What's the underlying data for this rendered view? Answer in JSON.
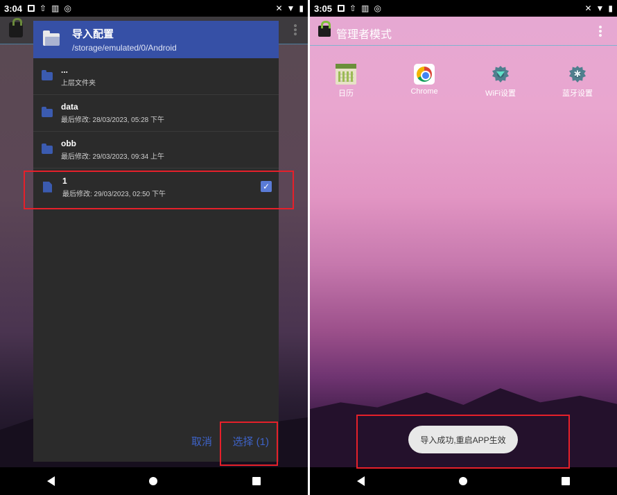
{
  "left": {
    "status": {
      "time": "3:04"
    },
    "dialog": {
      "title": "导入配置",
      "path": "/storage/emulated/0/Android",
      "items": [
        {
          "name": "...",
          "sub": "上层文件夹",
          "type": "folder"
        },
        {
          "name": "data",
          "sub": "最后修改: 28/03/2023, 05:28 下午",
          "type": "folder"
        },
        {
          "name": "obb",
          "sub": "最后修改: 29/03/2023, 09:34 上午",
          "type": "folder"
        },
        {
          "name": "1",
          "sub": "最后修改: 29/03/2023, 02:50 下午",
          "type": "file",
          "checked": true
        }
      ],
      "cancel_label": "取消",
      "select_label": "选择 (1)"
    }
  },
  "right": {
    "status": {
      "time": "3:05"
    },
    "header_title": "管理者模式",
    "apps": [
      {
        "label": "日历",
        "icon": "calendar-icon"
      },
      {
        "label": "Chrome",
        "icon": "chrome-icon"
      },
      {
        "label": "WiFi设置",
        "icon": "wifi-settings-icon"
      },
      {
        "label": "蓝牙设置",
        "icon": "bluetooth-settings-icon"
      }
    ],
    "toast": "导入成功,重启APP生效"
  },
  "colors": {
    "dialog_header": "#3650a6",
    "accent": "#3e63c8",
    "highlight_box": "#e6202a"
  }
}
